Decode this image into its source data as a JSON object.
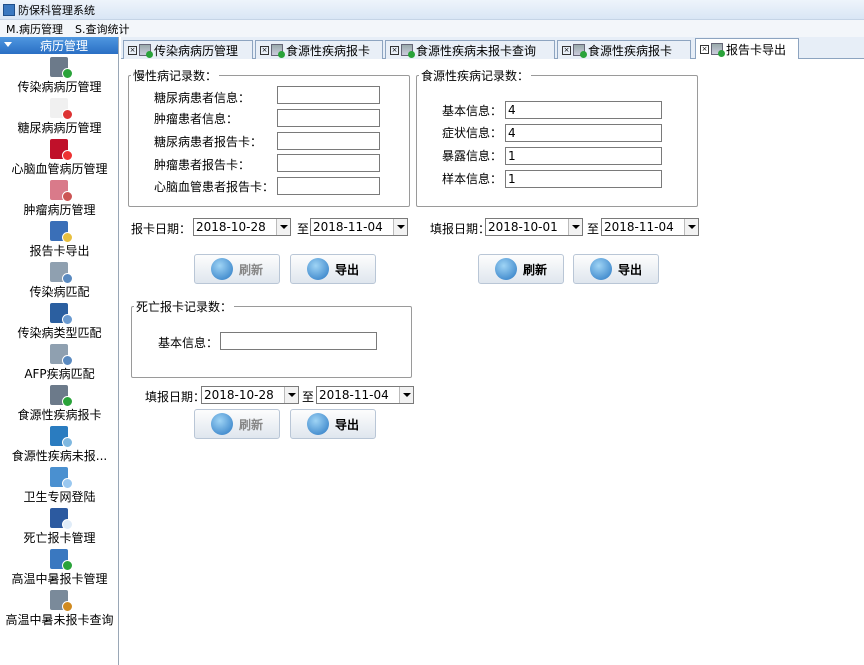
{
  "window": {
    "title": "防保科管理系统"
  },
  "menu": [
    "M.病历管理",
    "S.查询统计"
  ],
  "sidebar": {
    "header": "病历管理",
    "items": [
      {
        "label": "传染病病历管理",
        "icon": "document-add-icon"
      },
      {
        "label": "糖尿病病历管理",
        "icon": "medkit-icon"
      },
      {
        "label": "心脑血管病历管理",
        "icon": "heart-icon"
      },
      {
        "label": "肿瘤病历管理",
        "icon": "brain-icon"
      },
      {
        "label": "报告卡导出",
        "icon": "clipboard-icon"
      },
      {
        "label": "传染病匹配",
        "icon": "gears-icon"
      },
      {
        "label": "传染病类型匹配",
        "icon": "laptop-icon"
      },
      {
        "label": "AFP疾病匹配",
        "icon": "gears-icon"
      },
      {
        "label": "食源性疾病报卡",
        "icon": "document-add-icon"
      },
      {
        "label": "食源性疾病未报...",
        "icon": "magnifier-icon"
      },
      {
        "label": "卫生专网登陆",
        "icon": "network-icon"
      },
      {
        "label": "死亡报卡管理",
        "icon": "window-icon"
      },
      {
        "label": "高温中暑报卡管理",
        "icon": "checkmark-icon"
      },
      {
        "label": "高温中暑未报卡查询",
        "icon": "person-icon"
      }
    ]
  },
  "tabs": [
    {
      "label": "传染病病历管理",
      "active": false
    },
    {
      "label": "食源性疾病报卡",
      "active": false
    },
    {
      "label": "食源性疾病未报卡查询",
      "active": false
    },
    {
      "label": "食源性疾病报卡",
      "active": false
    },
    {
      "label": "报告卡导出",
      "active": true
    }
  ],
  "chronic": {
    "legend": "慢性病记录数：",
    "fields": [
      {
        "label": "糖尿病患者信息：",
        "value": ""
      },
      {
        "label": "肿瘤患者信息：",
        "value": ""
      },
      {
        "label": "糖尿病患者报告卡：",
        "value": ""
      },
      {
        "label": "肿瘤患者报告卡：",
        "value": ""
      },
      {
        "label": "心脑血管患者报告卡：",
        "value": ""
      }
    ],
    "date_label": "报卡日期：",
    "date_from": "2018-10-28",
    "to": "至",
    "date_to": "2018-11-04",
    "refresh": "刷新",
    "export": "导出"
  },
  "food": {
    "legend": "食源性疾病记录数：",
    "fields": [
      {
        "label": "基本信息：",
        "value": "4"
      },
      {
        "label": "症状信息：",
        "value": "4"
      },
      {
        "label": "暴露信息：",
        "value": "1"
      },
      {
        "label": "样本信息：",
        "value": "1"
      }
    ],
    "date_label": "填报日期：",
    "date_from": "2018-10-01",
    "to": "至",
    "date_to": "2018-11-04",
    "refresh": "刷新",
    "export": "导出"
  },
  "death": {
    "legend": "死亡报卡记录数：",
    "fields": [
      {
        "label": "基本信息：",
        "value": ""
      }
    ],
    "date_label": "填报日期：",
    "date_from": "2018-10-28",
    "to": "至",
    "date_to": "2018-11-04",
    "refresh": "刷新",
    "export": "导出"
  }
}
